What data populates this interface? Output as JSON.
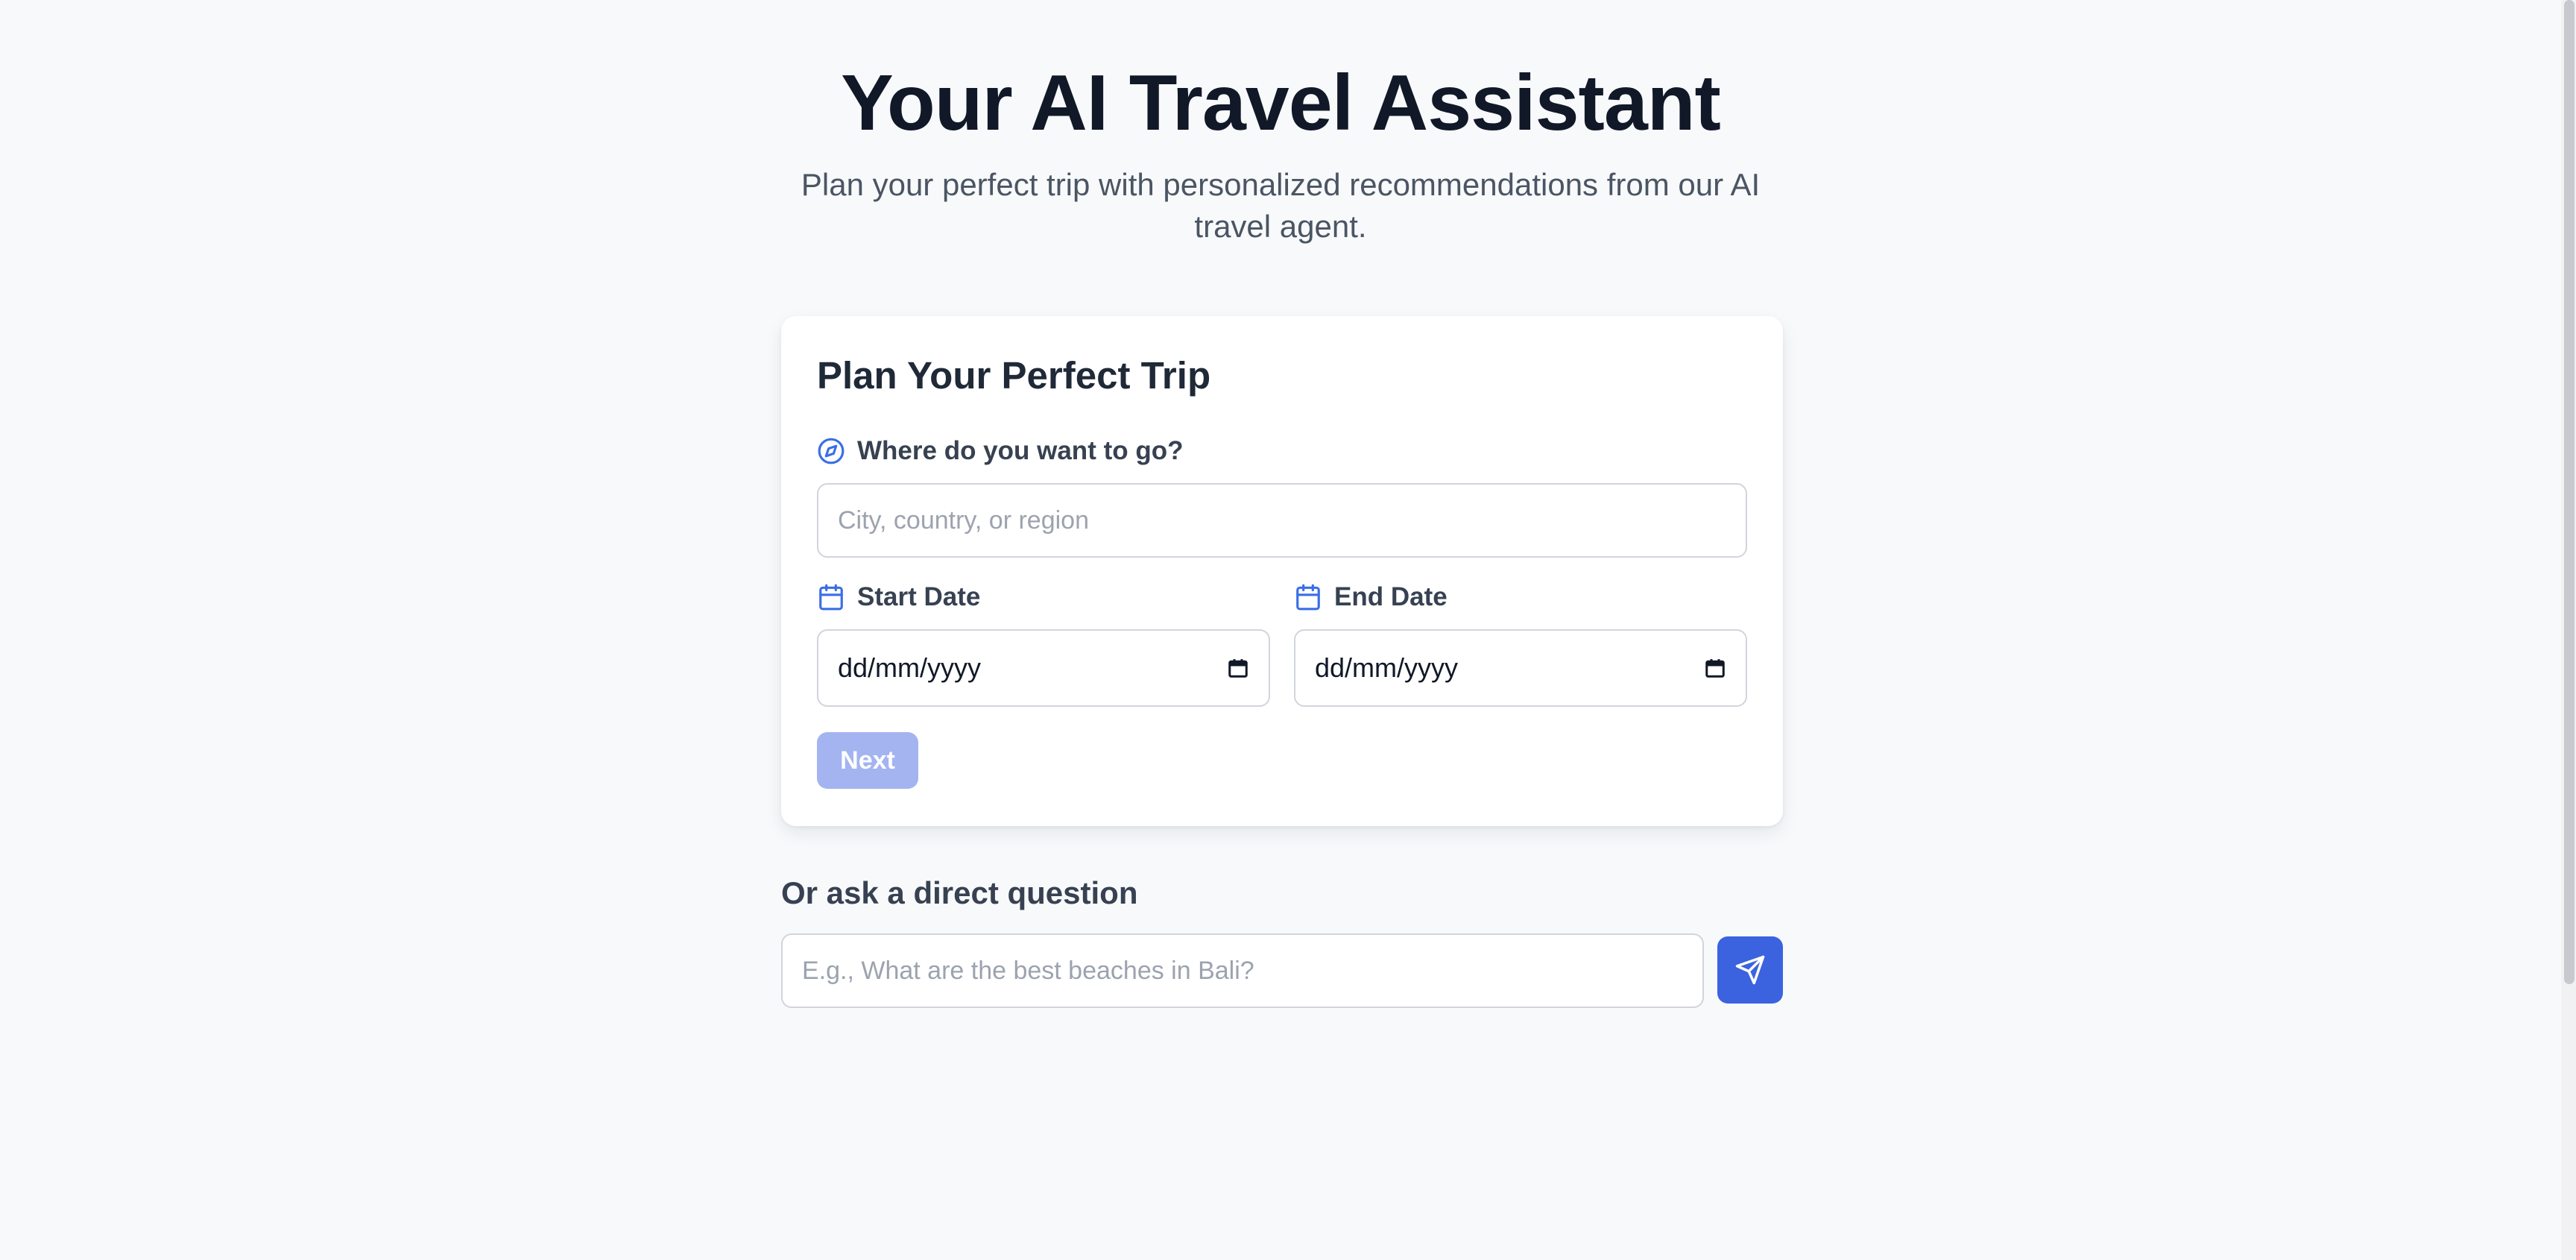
{
  "hero": {
    "title": "Your AI Travel Assistant",
    "subtitle": "Plan your perfect trip with personalized recommendations from our AI travel agent."
  },
  "planner": {
    "title": "Plan Your Perfect Trip",
    "destination": {
      "label": "Where do you want to go?",
      "placeholder": "City, country, or region",
      "icon": "compass-icon"
    },
    "start_date": {
      "label": "Start Date",
      "value": "dd/mm/yyyy",
      "icon": "calendar-icon"
    },
    "end_date": {
      "label": "End Date",
      "value": "dd/mm/yyyy",
      "icon": "calendar-icon"
    },
    "next_label": "Next"
  },
  "direct_question": {
    "title": "Or ask a direct question",
    "placeholder": "E.g., What are the best beaches in Bali?",
    "send_icon": "send-icon"
  },
  "colors": {
    "background": "#f8f9fb",
    "accent": "#3b63e0",
    "accent_disabled": "#a3b4f0",
    "icon_blue": "#3b6ee6"
  }
}
